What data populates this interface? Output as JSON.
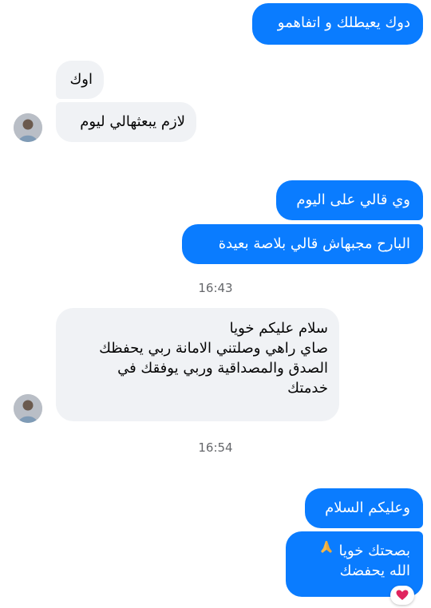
{
  "messages": [
    {
      "text": "دوك يعيطلك و اتفاهمو"
    },
    {
      "text": "اوك"
    },
    {
      "text": "لازم يبعثهالي ليوم"
    },
    {
      "text": "وي قالي على اليوم"
    },
    {
      "text": "البارح مجبهاش قالي بلاصة بعيدة"
    },
    {
      "lines": [
        "سلام عليكم خويا",
        "صاي راهي وصلتني الامانة  ربي يحفظك",
        "الصدق والمصداقية وربي يوفقك في",
        "خدمتك"
      ]
    },
    {
      "text": "وعليكم السلام"
    },
    {
      "line1": "بصحتك خويا",
      "line2": "الله يحفضك"
    }
  ],
  "timestamps": [
    "16:43",
    "16:54"
  ],
  "icons": {
    "avatar": "user-avatar",
    "prayer": "folded-hands-emoji",
    "reaction": "heart-emoji"
  },
  "colors": {
    "outgoing": "#0a7cff",
    "incoming": "#f0f2f5",
    "heart": "#e0245e"
  }
}
